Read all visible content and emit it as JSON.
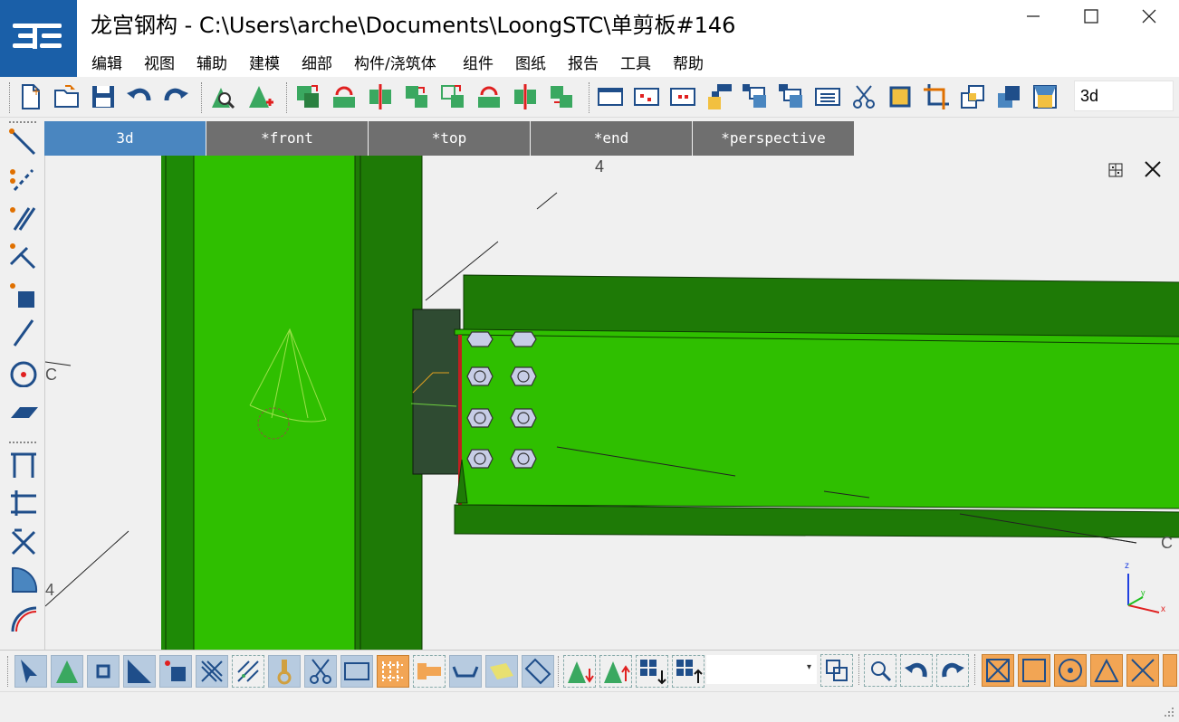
{
  "window": {
    "title": "龙宫钢构 - C:\\Users\\arche\\Documents\\LoongSTC\\单剪板#146",
    "minimize_label": "—",
    "maximize_label": "☐",
    "close_label": "✕"
  },
  "menu": {
    "items": [
      {
        "label": "编辑"
      },
      {
        "label": "视图"
      },
      {
        "label": "辅助"
      },
      {
        "label": "建模"
      },
      {
        "label": "细部"
      },
      {
        "label": "构件/浇筑体"
      },
      {
        "label": "组件"
      },
      {
        "label": "图纸"
      },
      {
        "label": "报告"
      },
      {
        "label": "工具"
      },
      {
        "label": "帮助"
      }
    ]
  },
  "toolbar": {
    "view_select_value": "3d"
  },
  "tabs": [
    {
      "label": "3d",
      "active": true
    },
    {
      "label": "*front",
      "active": false
    },
    {
      "label": "*top",
      "active": false
    },
    {
      "label": "*end",
      "active": false
    },
    {
      "label": "*perspective",
      "active": false
    }
  ],
  "viewport": {
    "grid_labels": {
      "top": "4",
      "left": "C",
      "bottom_left": "4",
      "right": "C"
    },
    "axis": {
      "z": "z",
      "y": "y",
      "x": "x"
    }
  },
  "bottom": {
    "select_value": ""
  },
  "colors": {
    "accent": "#1a5fa8",
    "tab_active": "#4a86c0",
    "tab_inactive": "#6f6f6f",
    "steel_green": "#2fbf00",
    "steel_dark": "#1e7a06",
    "plate_dark": "#2f4b32",
    "bolt": "#c7cde6"
  }
}
